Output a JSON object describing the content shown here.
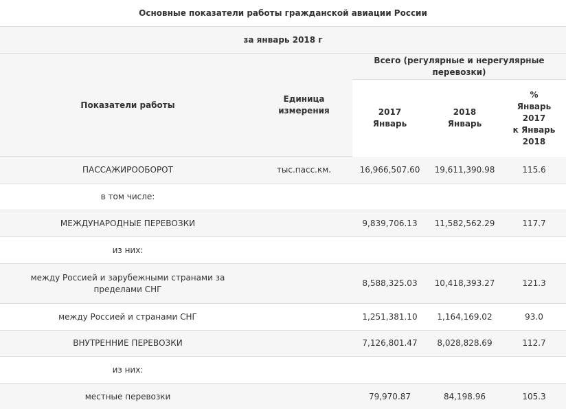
{
  "table": {
    "title": "Основные показатели работы гражданской авиации России",
    "period": "за январь 2018 г",
    "headers": {
      "indicator": "Показатели работы",
      "unit_line1": "Единица",
      "unit_line2": "измерения",
      "total": "Всего (регулярные и нерегулярные перевозки)",
      "y2017_line1": "2017",
      "y2017_line2": "Январь",
      "y2018_line1": "2018",
      "y2018_line2": "Январь",
      "pct_line1": "%",
      "pct_line2": "Январь",
      "pct_line3": "2017",
      "pct_line4": "к Январь",
      "pct_line5": "2018"
    },
    "rows": [
      {
        "name": "ПАССАЖИРООБОРОТ",
        "unit": "тыс.пасс.км.",
        "v2017": "16,966,507.60",
        "v2018": "19,611,390.98",
        "pct": "115.6"
      },
      {
        "name": "в том числе:",
        "unit": "",
        "v2017": "",
        "v2018": "",
        "pct": ""
      },
      {
        "name": "МЕЖДУНАРОДНЫЕ ПЕРЕВОЗКИ",
        "unit": "",
        "v2017": "9,839,706.13",
        "v2018": "11,582,562.29",
        "pct": "117.7"
      },
      {
        "name": "из них:",
        "unit": "",
        "v2017": "",
        "v2018": "",
        "pct": ""
      },
      {
        "name": "между Россией и зарубежными странами за пределами СНГ",
        "unit": "",
        "v2017": "8,588,325.03",
        "v2018": "10,418,393.27",
        "pct": "121.3"
      },
      {
        "name": "между Россией и странами СНГ",
        "unit": "",
        "v2017": "1,251,381.10",
        "v2018": "1,164,169.02",
        "pct": "93.0"
      },
      {
        "name": "ВНУТРЕННИЕ ПЕРЕВОЗКИ",
        "unit": "",
        "v2017": "7,126,801.47",
        "v2018": "8,028,828.69",
        "pct": "112.7"
      },
      {
        "name": "из них:",
        "unit": "",
        "v2017": "",
        "v2018": "",
        "pct": ""
      },
      {
        "name": "местные перевозки",
        "unit": "",
        "v2017": "79,970.87",
        "v2018": "84,198.96",
        "pct": "105.3"
      }
    ]
  }
}
